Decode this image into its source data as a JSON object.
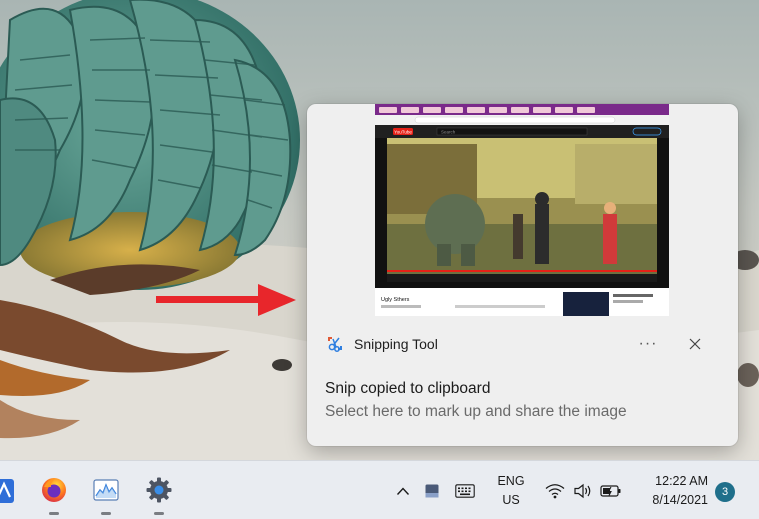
{
  "notification": {
    "app_name": "Snipping Tool",
    "more_label": "···",
    "title": "Snip copied to clipboard",
    "body": "Select here to mark up and share the image",
    "thumbnail": {
      "search_placeholder": "Search",
      "video_title": "Ugly Sthers",
      "brand": "YouTube"
    }
  },
  "taskbar": {
    "apps": [
      {
        "name": "partial-app-icon"
      },
      {
        "name": "firefox-icon"
      },
      {
        "name": "task-manager-icon"
      },
      {
        "name": "settings-icon"
      }
    ],
    "language": {
      "line1": "ENG",
      "line2": "US"
    },
    "clock": {
      "time": "12:22 AM",
      "date": "8/14/2021"
    },
    "notification_count": "3"
  },
  "colors": {
    "accent": "#1f6f8b",
    "arrow": "#e8262b",
    "toast_bg": "#efefef",
    "taskbar_bg": "#e9ecf1"
  }
}
